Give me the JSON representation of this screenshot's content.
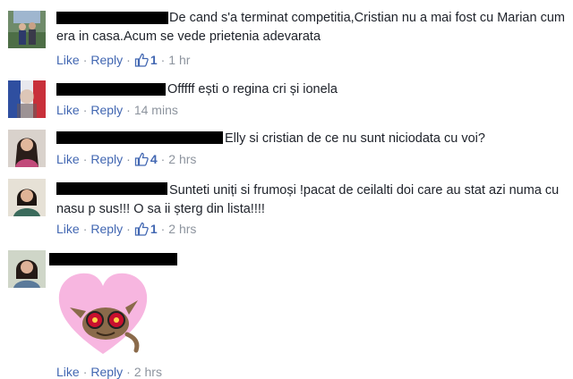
{
  "comments": [
    {
      "text": "De cand s'a terminat competitia,Cristian nu a mai fost cu Marian cum era in casa.Acum se vede prietenia adevarata",
      "like": "Like",
      "reply": "Reply",
      "likes": "1",
      "time": "1 hr"
    },
    {
      "text": "Offfff ești o regina cri și ionela",
      "like": "Like",
      "reply": "Reply",
      "likes": "",
      "time": "14 mins"
    },
    {
      "text": "Elly si cristian de ce nu sunt niciodata cu voi?",
      "like": "Like",
      "reply": "Reply",
      "likes": "4",
      "time": "2 hrs"
    },
    {
      "text": "Sunteti uniți si frumoși !pacat de ceilalti doi care au stat azi numa cu nasu p sus!!! O sa ii șterg din lista!!!!",
      "like": "Like",
      "reply": "Reply",
      "likes": "1",
      "time": "2 hrs"
    },
    {
      "text": "",
      "like": "Like",
      "reply": "Reply",
      "likes": "",
      "time": "2 hrs"
    }
  ],
  "icons": {
    "like_thumb": "thumbs-up-icon",
    "sticker": "cat-heart-sticker"
  },
  "colors": {
    "link": "#4267b2",
    "meta": "#8d949e",
    "text": "#1d2129",
    "sticker_heart": "#f7b6e0"
  }
}
